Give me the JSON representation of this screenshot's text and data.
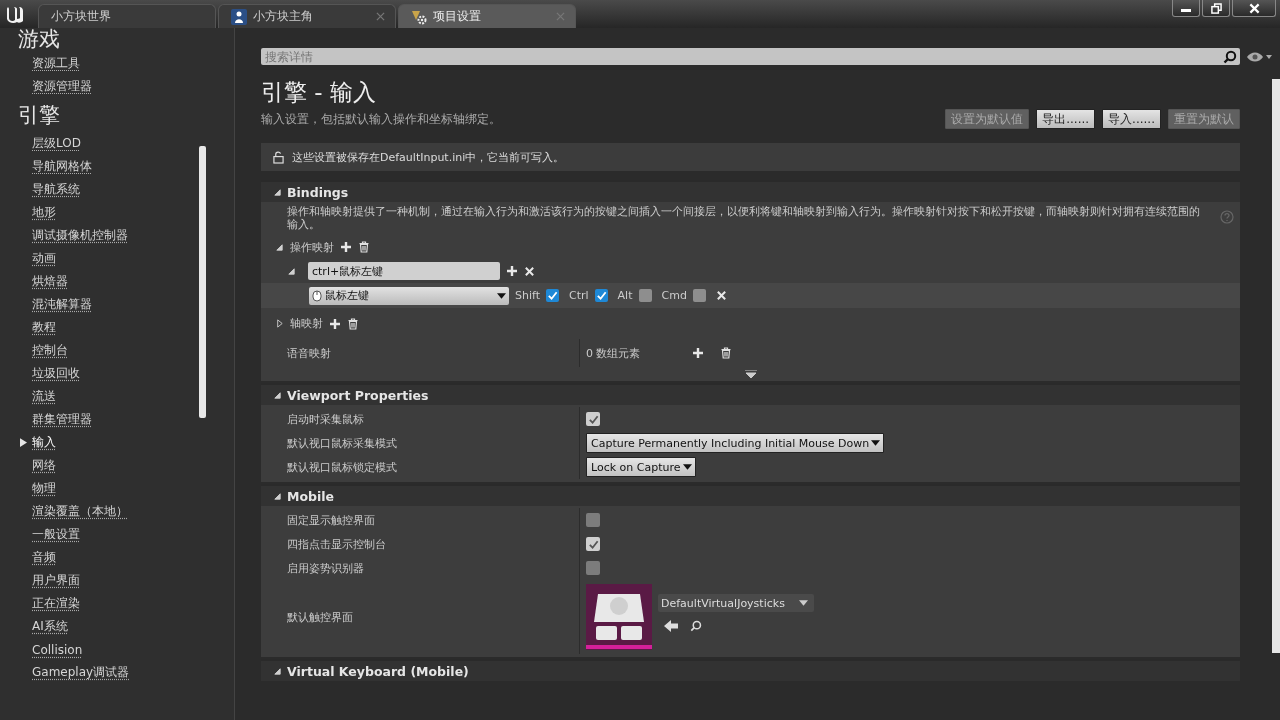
{
  "tabs": [
    {
      "label": "小方块世界",
      "selected": false
    },
    {
      "label": "小方块主角",
      "selected": false
    },
    {
      "label": "项目设置",
      "selected": true
    }
  ],
  "sidebar": {
    "sections": [
      {
        "title": "游戏",
        "items": [
          {
            "label": "资源工具",
            "selected": false
          },
          {
            "label": "资源管理器",
            "selected": false
          }
        ]
      },
      {
        "title": "引擎",
        "items": [
          {
            "label": "层级LOD",
            "selected": false
          },
          {
            "label": "导航网格体",
            "selected": false
          },
          {
            "label": "导航系统",
            "selected": false
          },
          {
            "label": "地形",
            "selected": false
          },
          {
            "label": "调试摄像机控制器",
            "selected": false
          },
          {
            "label": "动画",
            "selected": false
          },
          {
            "label": "烘焙器",
            "selected": false
          },
          {
            "label": "混沌解算器",
            "selected": false
          },
          {
            "label": "教程",
            "selected": false
          },
          {
            "label": "控制台",
            "selected": false
          },
          {
            "label": "垃圾回收",
            "selected": false
          },
          {
            "label": "流送",
            "selected": false
          },
          {
            "label": "群集管理器",
            "selected": false
          },
          {
            "label": "输入",
            "selected": true
          },
          {
            "label": "网络",
            "selected": false
          },
          {
            "label": "物理",
            "selected": false
          },
          {
            "label": "渲染覆盖（本地）",
            "selected": false
          },
          {
            "label": "一般设置",
            "selected": false
          },
          {
            "label": "音频",
            "selected": false
          },
          {
            "label": "用户界面",
            "selected": false
          },
          {
            "label": "正在渲染",
            "selected": false
          },
          {
            "label": "AI系统",
            "selected": false
          },
          {
            "label": "Collision",
            "selected": false
          },
          {
            "label": "Gameplay调试器",
            "selected": false
          }
        ]
      }
    ]
  },
  "search": {
    "placeholder": "搜索详情"
  },
  "page": {
    "title": "引擎 - 输入",
    "description": "输入设置，包括默认输入操作和坐标轴绑定。",
    "buttons": [
      {
        "label": "设置为默认值",
        "disabled": true
      },
      {
        "label": "导出......",
        "disabled": false
      },
      {
        "label": "导入......",
        "disabled": false
      },
      {
        "label": "重置为默认",
        "disabled": true
      }
    ],
    "notice": "这些设置被保存在DefaultInput.ini中，它当前可写入。"
  },
  "bindings": {
    "title": "Bindings",
    "expanded": true,
    "description": "操作和轴映射提供了一种机制，通过在输入行为和激活该行为的按键之间插入一个间接层，以便利将键和轴映射到输入行为。操作映射针对按下和松开按键，而轴映射则针对拥有连续范围的输入。",
    "action_mappings": {
      "label": "操作映射",
      "expanded": true,
      "mappings": [
        {
          "name": "ctrl+鼠标左键",
          "expanded": true,
          "keys": [
            {
              "key": "鼠标左键",
              "modifiers": [
                {
                  "label": "Shift",
                  "checked": true
                },
                {
                  "label": "Ctrl",
                  "checked": true
                },
                {
                  "label": "Alt",
                  "checked": false
                },
                {
                  "label": "Cmd",
                  "checked": false
                }
              ]
            }
          ]
        }
      ]
    },
    "axis_mappings": {
      "label": "轴映射",
      "expanded": false
    },
    "speech_mappings": {
      "label": "语音映射",
      "value": "0 数组元素"
    }
  },
  "categories": [
    {
      "title": "Viewport Properties",
      "expanded": true,
      "rows": [
        {
          "kind": "checkbox",
          "label": "启动时采集鼠标",
          "checked": true
        },
        {
          "kind": "dropdown",
          "label": "默认视口鼠标采集模式",
          "value": "Capture Permanently Including Initial Mouse Down"
        },
        {
          "kind": "dropdown",
          "label": "默认视口鼠标锁定模式",
          "value": "Lock on Capture"
        }
      ]
    },
    {
      "title": "Mobile",
      "expanded": true,
      "rows": [
        {
          "kind": "checkbox",
          "label": "固定显示触控界面",
          "checked": false
        },
        {
          "kind": "checkbox",
          "label": "四指点击显示控制台",
          "checked": true
        },
        {
          "kind": "checkbox",
          "label": "启用姿势识别器",
          "checked": false
        },
        {
          "kind": "asset",
          "label": "默认触控界面",
          "value": "DefaultVirtualJoysticks"
        }
      ]
    },
    {
      "title": "Virtual Keyboard (Mobile)",
      "expanded": true
    }
  ]
}
